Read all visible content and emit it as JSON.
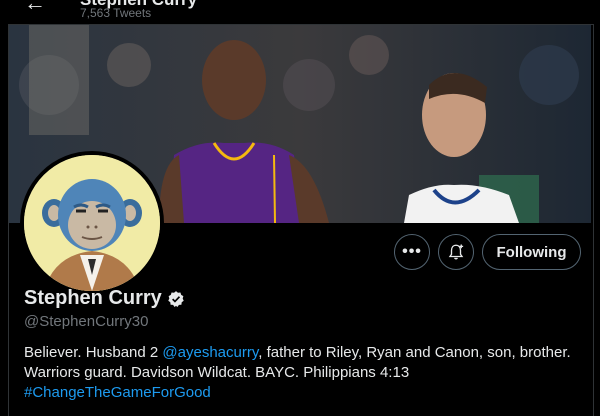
{
  "header": {
    "title": "Stephen Curry",
    "tweet_count": "7,563 Tweets"
  },
  "banner": {
    "description_icon": "photo-banner"
  },
  "actions": {
    "more_icon": "more-dots-icon",
    "more_label": "•••",
    "notify_icon": "bell-plus-icon",
    "following_label": "Following"
  },
  "profile": {
    "name": "Stephen Curry",
    "handle": "@StephenCurry30",
    "bio_part1": "Believer. Husband 2 ",
    "bio_mention": "@ayeshacurry",
    "bio_part2": ", father to Riley, Ryan and Canon, son, brother. Warriors guard. Davidson Wildcat. BAYC. Philippians 4:13",
    "bio_hashtag": "#ChangeTheGameForGood"
  },
  "colors": {
    "background": "#000000",
    "link": "#1d9bf0",
    "muted": "#71767b",
    "verified": "#e7e9ea"
  }
}
